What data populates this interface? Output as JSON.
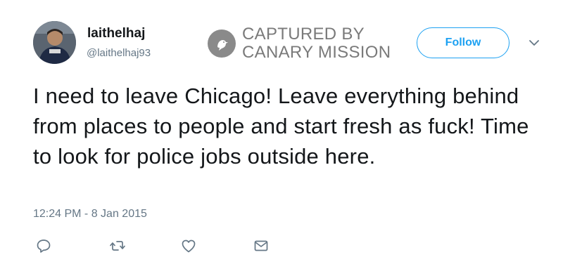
{
  "user": {
    "display_name": "laithelhaj",
    "handle": "@laithelhaj93",
    "avatar_icon": "profile-photo"
  },
  "watermark": {
    "line1": "CAPTURED BY",
    "line2": "CANARY MISSION",
    "icon": "canary-bird-icon"
  },
  "follow_button": {
    "label": "Follow"
  },
  "menu_icon": "chevron-down-icon",
  "tweet": {
    "text": "I need to leave Chicago! Leave everything behind from places to people and start fresh as fuck! Time to look for police jobs outside here.",
    "timestamp": "12:24 PM - 8 Jan 2015"
  },
  "actions": [
    {
      "icon": "reply-icon"
    },
    {
      "icon": "retweet-icon"
    },
    {
      "icon": "like-icon"
    },
    {
      "icon": "direct-message-icon"
    }
  ],
  "colors": {
    "accent": "#1da1f2",
    "secondary_text": "#657786",
    "primary_text": "#14171a",
    "watermark": "#7a7a7a"
  }
}
